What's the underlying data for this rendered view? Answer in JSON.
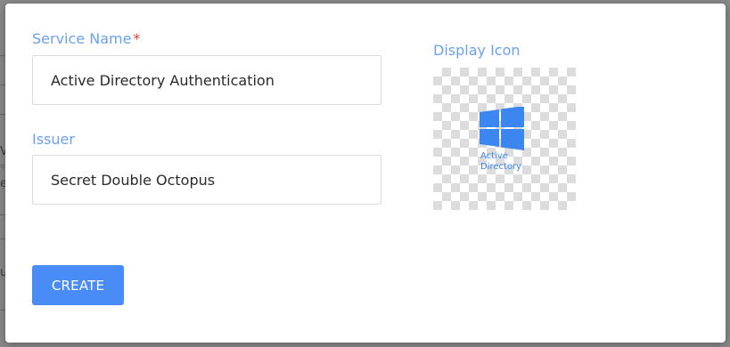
{
  "background_fragments": [
    "V",
    "e",
    "e",
    "u"
  ],
  "form": {
    "service_name": {
      "label": "Service Name",
      "required_marker": "*",
      "value": "Active Directory Authentication"
    },
    "issuer": {
      "label": "Issuer",
      "value": "Secret Double Octopus"
    },
    "create_label": "CREATE"
  },
  "display_icon": {
    "label": "Display Icon",
    "icon": "windows-active-directory-icon",
    "logo_line1": "Active",
    "logo_line2": "Directory"
  },
  "colors": {
    "accent": "#4a8cf7",
    "label": "#6aa2ee",
    "required": "#e53935",
    "logo": "#3b86f0"
  }
}
